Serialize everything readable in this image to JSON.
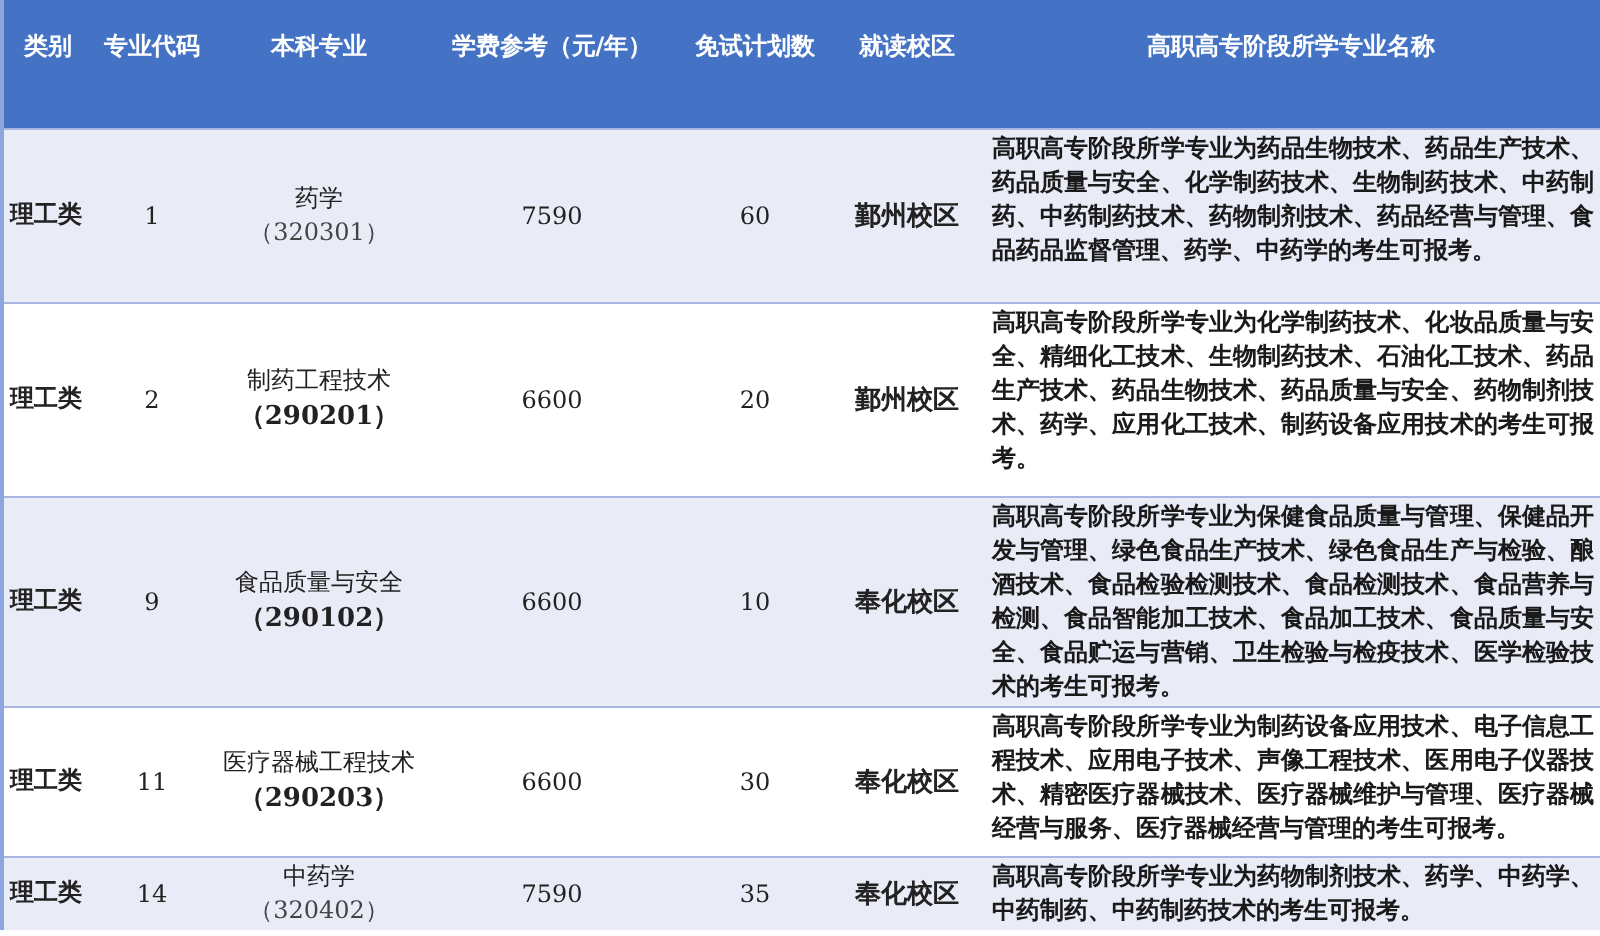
{
  "table": {
    "columns": [
      "类别",
      "专业代码",
      "本科专业",
      "学费参考（元/年）",
      "免试计划数",
      "就读校区",
      "高职高专阶段所学专业名称"
    ],
    "rows": [
      {
        "category": "理工类",
        "code": "1",
        "major": "药学",
        "major_code": "（320301）",
        "major_code_bold": false,
        "fee": "7590",
        "quota": "60",
        "campus": "鄞州校区",
        "eligible": "高职高专阶段所学专业为药品生物技术、药品生产技术、药品质量与安全、化学制药技术、生物制药技术、中药制药、中药制药技术、药物制剂技术、药品经营与管理、食品药品监督管理、药学、中药学的考生可报考。"
      },
      {
        "category": "理工类",
        "code": "2",
        "major": "制药工程技术",
        "major_code": "（290201）",
        "major_code_bold": true,
        "fee": "6600",
        "quota": "20",
        "campus": "鄞州校区",
        "eligible": "高职高专阶段所学专业为化学制药技术、化妆品质量与安全、精细化工技术、生物制药技术、石油化工技术、药品生产技术、药品生物技术、药品质量与安全、药物制剂技术、药学、应用化工技术、制药设备应用技术的考生可报考。"
      },
      {
        "category": "理工类",
        "code": "9",
        "major": "食品质量与安全",
        "major_code": "（290102）",
        "major_code_bold": true,
        "fee": "6600",
        "quota": "10",
        "campus": "奉化校区",
        "eligible": "高职高专阶段所学专业为保健食品质量与管理、保健品开发与管理、绿色食品生产技术、绿色食品生产与检验、酿酒技术、食品检验检测技术、食品检测技术、食品营养与检测、食品智能加工技术、食品加工技术、食品质量与安全、食品贮运与营销、卫生检验与检疫技术、医学检验技术的考生可报考。"
      },
      {
        "category": "理工类",
        "code": "11",
        "major": "医疗器械工程技术",
        "major_code": "（290203）",
        "major_code_bold": true,
        "fee": "6600",
        "quota": "30",
        "campus": "奉化校区",
        "eligible": "高职高专阶段所学专业为制药设备应用技术、电子信息工程技术、应用电子技术、声像工程技术、医用电子仪器技术、精密医疗器械技术、医疗器械维护与管理、医疗器械经营与服务、医疗器械经营与管理的考生可报考。"
      },
      {
        "category": "理工类",
        "code": "14",
        "major": "中药学",
        "major_code": "（320402）",
        "major_code_bold": false,
        "fee": "7590",
        "quota": "35",
        "campus": "奉化校区",
        "eligible": "高职高专阶段所学专业为药物制剂技术、药学、中药学、中药制药、中药制药技术的考生可报考。"
      }
    ]
  }
}
